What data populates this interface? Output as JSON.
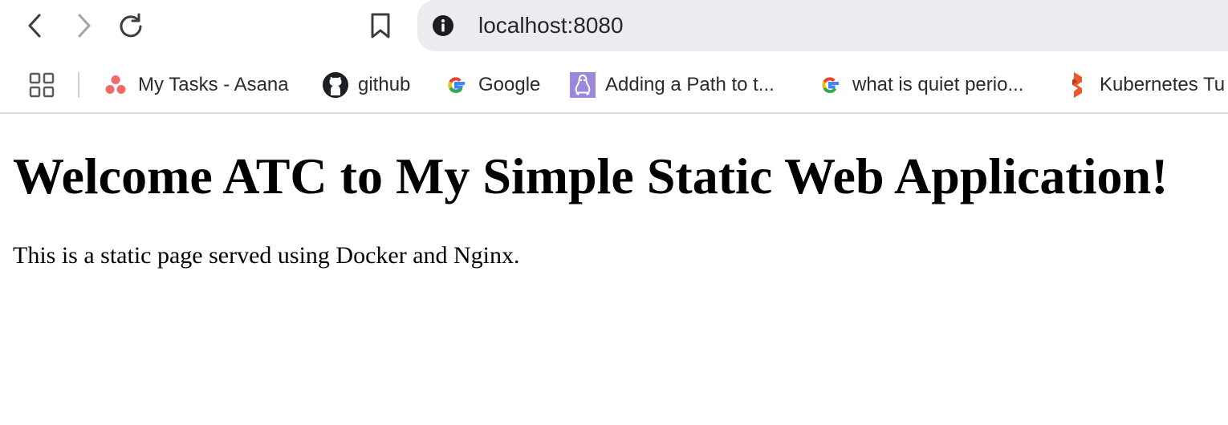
{
  "toolbar": {
    "back_icon": "chevron-left-icon",
    "forward_icon": "chevron-right-icon",
    "reload_icon": "reload-icon",
    "bookmark_icon": "bookmark-icon",
    "info_icon": "info-icon",
    "url": "localhost:8080"
  },
  "bookmarks": {
    "apps_icon": "apps-grid-icon",
    "items": [
      {
        "label": "My Tasks - Asana",
        "icon": "asana-icon"
      },
      {
        "label": "github",
        "icon": "github-icon"
      },
      {
        "label": "Google",
        "icon": "google-icon"
      },
      {
        "label": "Adding a Path to t...",
        "icon": "linux-tux-icon"
      },
      {
        "label": "what is quiet perio...",
        "icon": "google-icon"
      },
      {
        "label": "Kubernetes Tu",
        "icon": "kubernetes-tutorial-icon"
      }
    ]
  },
  "page": {
    "heading": "Welcome ATC to My Simple Static Web Application!",
    "paragraph": "This is a static page served using Docker and Nginx."
  },
  "colors": {
    "address_bar_bg": "#ecebf0",
    "asana": "#f06a6a",
    "linux_bg": "#9b87db",
    "k8s_orange": "#e8592b"
  }
}
